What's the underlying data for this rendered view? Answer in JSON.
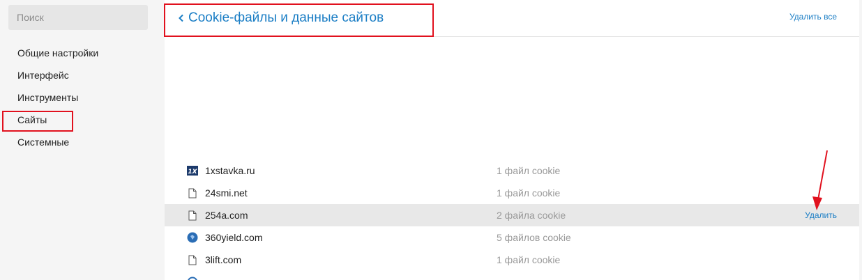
{
  "sidebar": {
    "search_placeholder": "Поиск",
    "items": [
      {
        "label": "Общие настройки"
      },
      {
        "label": "Интерфейс"
      },
      {
        "label": "Инструменты"
      },
      {
        "label": "Сайты"
      },
      {
        "label": "Системные"
      }
    ]
  },
  "header": {
    "title": "Cookie-файлы и данные сайтов",
    "delete_all": "Удалить все"
  },
  "sites": [
    {
      "domain": "1xstavka.ru",
      "count": "1 файл cookie",
      "icon": "1x-favicon-icon"
    },
    {
      "domain": "24smi.net",
      "count": "1 файл cookie",
      "icon": "file-icon"
    },
    {
      "domain": "254a.com",
      "count": "2 файла cookie",
      "icon": "file-icon",
      "delete": "Удалить"
    },
    {
      "domain": "360yield.com",
      "count": "5 файлов cookie",
      "icon": "blue-circle-favicon-icon"
    },
    {
      "domain": "3lift.com",
      "count": "1 файл cookie",
      "icon": "file-icon"
    }
  ],
  "colors": {
    "accent": "#1b7ec5",
    "annotation": "#e1111e",
    "hover_row": "#e8e8e8"
  }
}
